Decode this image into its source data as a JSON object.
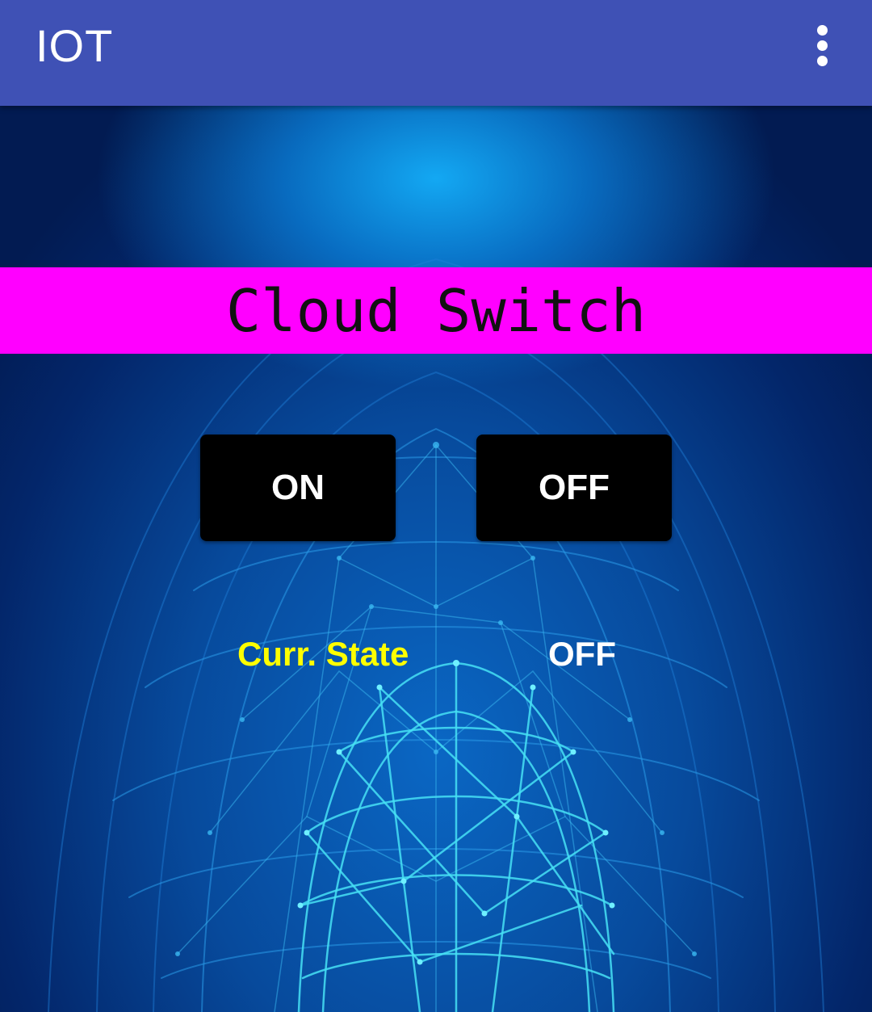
{
  "appbar": {
    "title": "IOT",
    "overflow_icon": "more-vert-icon"
  },
  "banner": {
    "title": "Cloud Switch"
  },
  "controls": {
    "on_label": "ON",
    "off_label": "OFF"
  },
  "status": {
    "label": "Curr. State",
    "value": "OFF"
  },
  "colors": {
    "appbar": "#3f51b5",
    "banner": "#ff00ff",
    "button": "#000000",
    "state_label": "#ffff00",
    "state_value": "#ffffff"
  },
  "background": {
    "image": "network-globe-mesh"
  }
}
